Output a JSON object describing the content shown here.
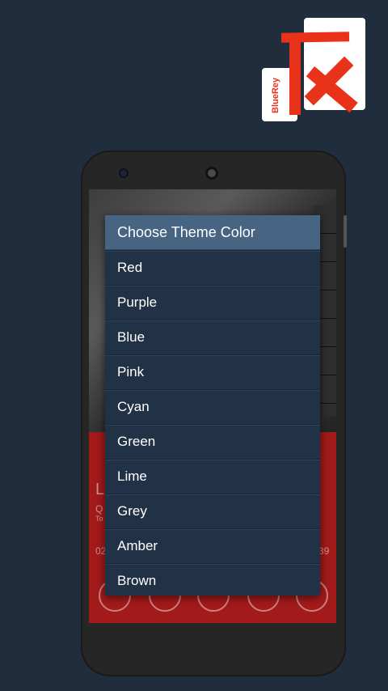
{
  "logo": {
    "text": "BlueRey",
    "colors": {
      "red": "#e8321a",
      "card": "#ffffff"
    }
  },
  "player": {
    "time_left": "02",
    "time_right": "39",
    "title_initial": "L",
    "artist_initial": "Q",
    "album_initial": "To"
  },
  "dialog": {
    "title": "Choose Theme Color",
    "options": [
      "Red",
      "Purple",
      "Blue",
      "Pink",
      "Cyan",
      "Green",
      "Lime",
      "Grey",
      "Amber",
      "Brown"
    ]
  },
  "colors": {
    "background": "#1f2d3c",
    "dialog_bg": "#223246",
    "dialog_header": "#476583",
    "player_accent": "#a31a1a"
  }
}
